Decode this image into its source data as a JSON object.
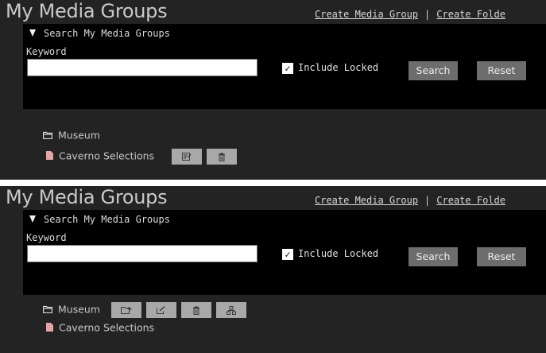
{
  "panels": [
    {
      "title": "My Media Groups",
      "header_links": {
        "create_group": "Create Media Group",
        "separator": "|",
        "create_folder": "Create Folde"
      },
      "search": {
        "header": "Search My Media Groups",
        "keyword_label": "Keyword",
        "keyword_value": "",
        "include_locked_label": "Include Locked",
        "include_locked_checked": true,
        "search_label": "Search",
        "reset_label": "Reset"
      },
      "tree": [
        {
          "label": "Museum",
          "type": "folder",
          "actions": []
        },
        {
          "label": "Caverno Selections",
          "type": "group",
          "actions": [
            "edit-icon",
            "trash-icon"
          ]
        }
      ]
    },
    {
      "title": "My Media Groups",
      "header_links": {
        "create_group": "Create Media Group",
        "separator": "|",
        "create_folder": "Create Folde"
      },
      "search": {
        "header": "Search My Media Groups",
        "keyword_label": "Keyword",
        "keyword_value": "",
        "include_locked_label": "Include Locked",
        "include_locked_checked": true,
        "search_label": "Search",
        "reset_label": "Reset"
      },
      "tree": [
        {
          "label": "Museum",
          "type": "folder",
          "actions": [
            "add-subfolder-icon",
            "edit-icon",
            "trash-icon",
            "hierarchy-icon"
          ]
        },
        {
          "label": "Caverno Selections",
          "type": "group",
          "actions": []
        }
      ]
    }
  ],
  "colors": {
    "background": "#232323",
    "search_box": "#000000",
    "button": "#6d6d6d",
    "action_button": "#a8a8a8",
    "text": "#c7c7c7"
  }
}
